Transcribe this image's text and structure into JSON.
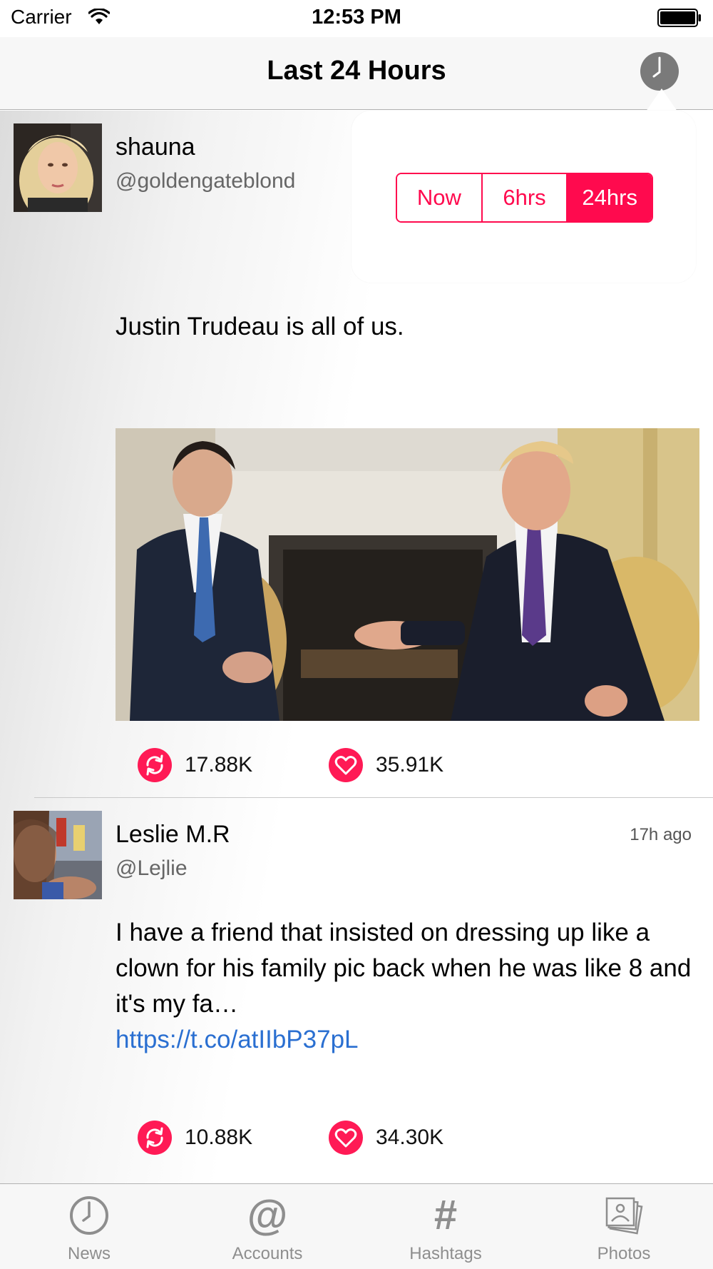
{
  "status_bar": {
    "carrier": "Carrier",
    "time": "12:53 PM"
  },
  "nav": {
    "title": "Last 24 Hours",
    "clock_icon": "clock-icon"
  },
  "time_filter": {
    "options": [
      "Now",
      "6hrs",
      "24hrs"
    ],
    "selected": "24hrs",
    "accent_color": "#ff0a4e"
  },
  "tweets": [
    {
      "name": "shauna",
      "handle": "@goldengateblond",
      "time": "",
      "text": "Justin Trudeau is all of us.",
      "link": "",
      "retweets": "17.88K",
      "likes": "35.91K"
    },
    {
      "name": "Leslie M.R",
      "handle": "@Lejlie",
      "time": "17h ago",
      "text": "I have a friend that insisted on dressing up like a clown for his family pic back when he was like 8 and it's my fa…",
      "link": "https://t.co/atIIbP37pL",
      "retweets": "10.88K",
      "likes": "34.30K"
    }
  ],
  "tab_bar": {
    "items": [
      {
        "label": "News",
        "icon": "clock-icon"
      },
      {
        "label": "Accounts",
        "icon": "at-sign-icon"
      },
      {
        "label": "Hashtags",
        "icon": "hashtag-icon"
      },
      {
        "label": "Photos",
        "icon": "photos-icon"
      }
    ]
  },
  "colors": {
    "accent": "#ff1a55",
    "link": "#2a6fd1",
    "tab_inactive": "#8e8e8e"
  }
}
